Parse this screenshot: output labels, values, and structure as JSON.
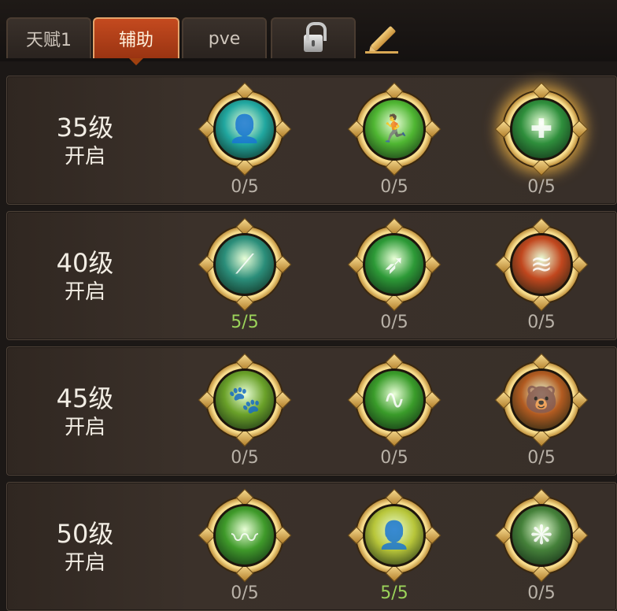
{
  "tabs": [
    {
      "label": "天赋1",
      "active": false
    },
    {
      "label": "辅助",
      "active": true
    },
    {
      "label": "pve",
      "active": false
    }
  ],
  "colors": {
    "accent": "#c44a1f",
    "maxed_text": "#9bd35a",
    "normal_text": "#b9b2a8",
    "gold": "#e8c078"
  },
  "rows": [
    {
      "level": "35级",
      "open": "开启",
      "skills": [
        {
          "icon": "silhouette-figure-icon",
          "count": "0/5",
          "bg": "#21a7a0",
          "glyph": "👤"
        },
        {
          "icon": "running-figure-icon",
          "count": "0/5",
          "bg": "#4fb632",
          "glyph": "🏃"
        },
        {
          "icon": "green-cross-heal-icon",
          "count": "0/5",
          "bg": "#2f8f3c",
          "glyph": "✚",
          "highlight": true
        }
      ]
    },
    {
      "level": "40级",
      "open": "开启",
      "skills": [
        {
          "icon": "spear-tip-icon",
          "count": "5/5",
          "bg": "#2b8e7a",
          "glyph": "⟋",
          "maxed": true
        },
        {
          "icon": "arrow-bolt-icon",
          "count": "0/5",
          "bg": "#2d9a37",
          "glyph": "➶"
        },
        {
          "icon": "claw-slash-icon",
          "count": "0/5",
          "bg": "#c1471e",
          "glyph": "≋"
        }
      ]
    },
    {
      "level": "45级",
      "open": "开启",
      "skills": [
        {
          "icon": "roaring-beast-icon",
          "count": "0/5",
          "bg": "#6aa129",
          "glyph": "🐾"
        },
        {
          "icon": "green-serpent-icon",
          "count": "0/5",
          "bg": "#3a9c2a",
          "glyph": "∿"
        },
        {
          "icon": "bear-head-icon",
          "count": "0/5",
          "bg": "#b25b21",
          "glyph": "🐻"
        }
      ]
    },
    {
      "level": "50级",
      "open": "开启",
      "skills": [
        {
          "icon": "green-snake-icon",
          "count": "0/5",
          "bg": "#3f9a2a",
          "glyph": "〰"
        },
        {
          "icon": "glowing-figure-icon",
          "count": "5/5",
          "bg": "#b8c63a",
          "glyph": "👤",
          "maxed": true
        },
        {
          "icon": "forest-spirit-icon",
          "count": "0/5",
          "bg": "#45813a",
          "glyph": "❋"
        }
      ]
    }
  ]
}
